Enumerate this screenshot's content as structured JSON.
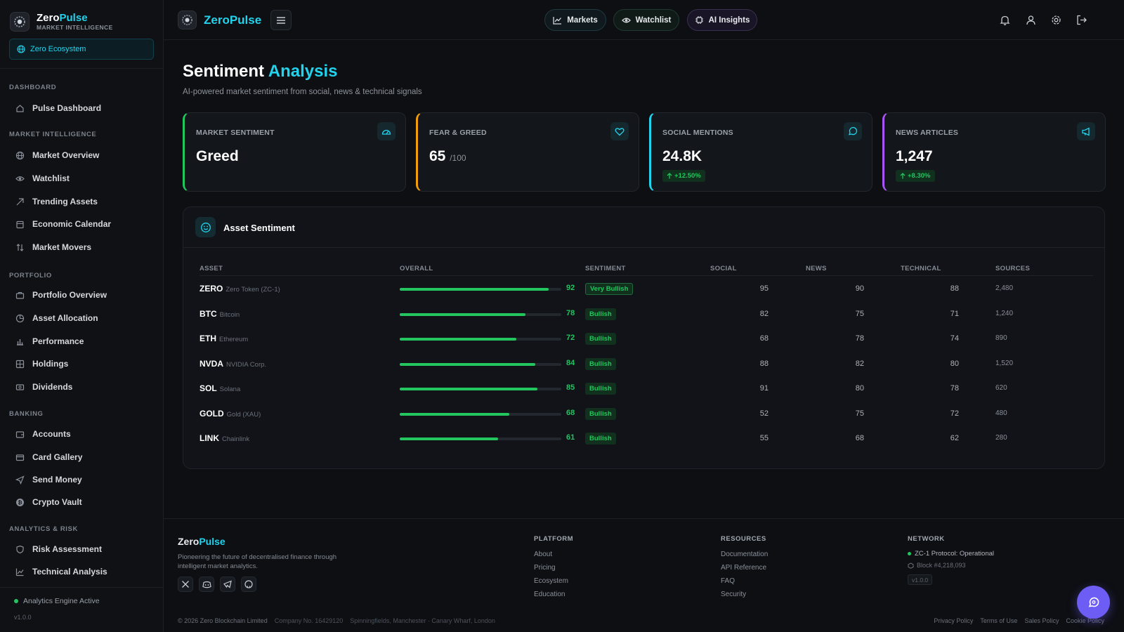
{
  "sidebar": {
    "brand_name_1": "Zero",
    "brand_name_2": "Pulse",
    "brand_sub": "MARKET INTELLIGENCE",
    "eco_label": "Zero Ecosystem",
    "sections": {
      "dashboard": "DASHBOARD",
      "market": "MARKET INTELLIGENCE",
      "portfolio": "PORTFOLIO",
      "banking": "BANKING",
      "analytics": "ANALYTICS & RISK"
    },
    "items": {
      "pulse_dashboard": "Pulse Dashboard",
      "market_overview": "Market Overview",
      "watchlist": "Watchlist",
      "trending_assets": "Trending Assets",
      "economic_calendar": "Economic Calendar",
      "market_movers": "Market Movers",
      "portfolio_overview": "Portfolio Overview",
      "asset_allocation": "Asset Allocation",
      "performance": "Performance",
      "holdings": "Holdings",
      "dividends": "Dividends",
      "accounts": "Accounts",
      "card_gallery": "Card Gallery",
      "send_money": "Send Money",
      "crypto_vault": "Crypto Vault",
      "risk_assessment": "Risk Assessment",
      "technical_analysis": "Technical Analysis"
    },
    "engine_status": "Analytics Engine Active",
    "version": "v1.0.0"
  },
  "topbar": {
    "brand": "ZeroPulse",
    "nav": {
      "markets": "Markets",
      "watchlist": "Watchlist",
      "ai_insights": "AI Insights"
    }
  },
  "page": {
    "title_1": "Sentiment",
    "title_2": "Analysis",
    "subtitle": "AI-powered market sentiment from social, news & technical signals"
  },
  "cards": {
    "market_sentiment": {
      "label": "MARKET SENTIMENT",
      "value": "Greed",
      "accent": "#22c55e"
    },
    "fear_greed": {
      "label": "FEAR & GREED",
      "value": "65",
      "unit": "/100",
      "accent": "#f59e0b"
    },
    "social_mentions": {
      "label": "SOCIAL MENTIONS",
      "value": "24.8K",
      "change": "+12.50%",
      "accent": "#22d3ee"
    },
    "news_articles": {
      "label": "NEWS ARTICLES",
      "value": "1,247",
      "change": "+8.30%",
      "accent": "#a855f7"
    }
  },
  "asset_panel": {
    "title": "Asset Sentiment",
    "columns": {
      "asset": "ASSET",
      "overall": "OVERALL",
      "sentiment": "SENTIMENT",
      "social": "SOCIAL",
      "news": "NEWS",
      "technical": "TECHNICAL",
      "sources": "SOURCES"
    },
    "rows": [
      {
        "symbol": "ZERO",
        "name": "Zero Token (ZC-1)",
        "overall": "92",
        "sentiment": "Very Bullish",
        "social": "95",
        "news": "90",
        "technical": "88",
        "sources": "2,480"
      },
      {
        "symbol": "BTC",
        "name": "Bitcoin",
        "overall": "78",
        "sentiment": "Bullish",
        "social": "82",
        "news": "75",
        "technical": "71",
        "sources": "1,240"
      },
      {
        "symbol": "ETH",
        "name": "Ethereum",
        "overall": "72",
        "sentiment": "Bullish",
        "social": "68",
        "news": "78",
        "technical": "74",
        "sources": "890"
      },
      {
        "symbol": "NVDA",
        "name": "NVIDIA Corp.",
        "overall": "84",
        "sentiment": "Bullish",
        "social": "88",
        "news": "82",
        "technical": "80",
        "sources": "1,520"
      },
      {
        "symbol": "SOL",
        "name": "Solana",
        "overall": "85",
        "sentiment": "Bullish",
        "social": "91",
        "news": "80",
        "technical": "78",
        "sources": "620"
      },
      {
        "symbol": "GOLD",
        "name": "Gold (XAU)",
        "overall": "68",
        "sentiment": "Bullish",
        "social": "52",
        "news": "75",
        "technical": "72",
        "sources": "480"
      },
      {
        "symbol": "LINK",
        "name": "Chainlink",
        "overall": "61",
        "sentiment": "Bullish",
        "social": "55",
        "news": "68",
        "technical": "62",
        "sources": "280"
      }
    ]
  },
  "footer": {
    "brand_1": "Zero",
    "brand_2": "Pulse",
    "description": "Pioneering the future of decentralised finance through intelligent market analytics.",
    "platform": {
      "title": "PLATFORM",
      "links": [
        "About",
        "Pricing",
        "Ecosystem",
        "Education"
      ]
    },
    "resources": {
      "title": "RESOURCES",
      "links": [
        "Documentation",
        "API Reference",
        "FAQ",
        "Security"
      ]
    },
    "network": {
      "title": "NETWORK",
      "status": "ZC-1 Protocol: Operational",
      "block": "Block #4,218,093",
      "version": "v1.0.0"
    },
    "copyright": "© 2026 Zero Blockchain Limited",
    "company": "Company No. 16429120",
    "address": "Spinningfields, Manchester · Canary Wharf, London",
    "legal": [
      "Privacy Policy",
      "Terms of Use",
      "Sales Policy",
      "Cookie Policy"
    ]
  },
  "colors": {
    "accent": "#22d3ee",
    "positive": "#22c55e",
    "fab": "#6d5df5"
  }
}
